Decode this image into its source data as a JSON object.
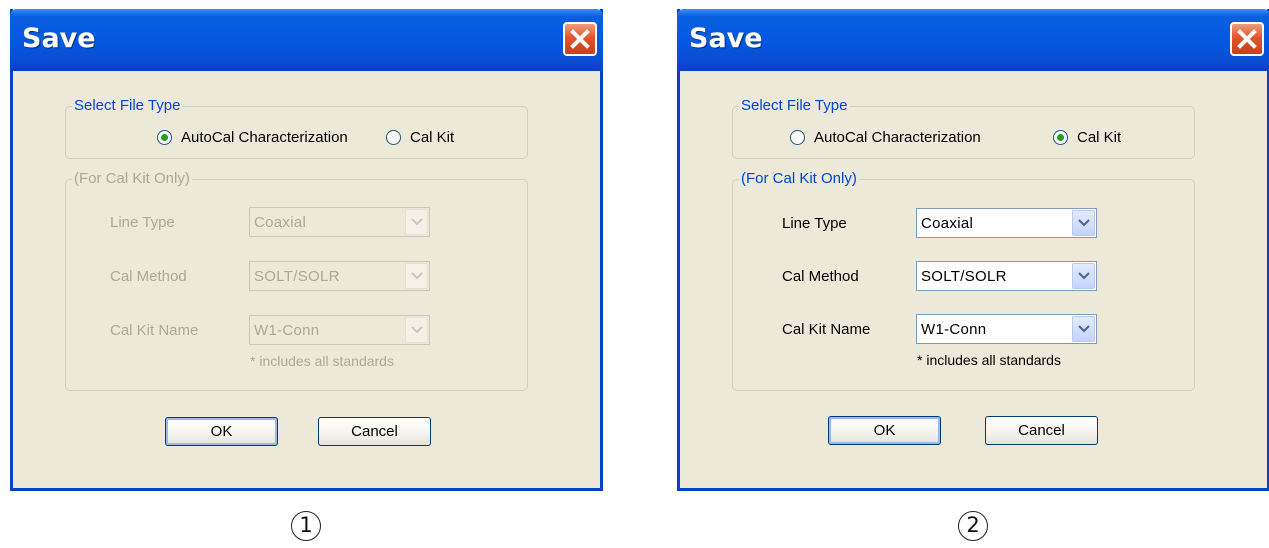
{
  "dialogs": [
    {
      "title": "Save",
      "file_type": {
        "legend": "Select File Type",
        "options": [
          "AutoCal Characterization",
          "Cal Kit"
        ],
        "selected": "AutoCal Characterization"
      },
      "cal_kit": {
        "legend": "(For Cal Kit Only)",
        "enabled": false,
        "line_type": {
          "label": "Line Type",
          "value": "Coaxial"
        },
        "cal_method": {
          "label": "Cal Method",
          "value": "SOLT/SOLR"
        },
        "cal_kit_name": {
          "label": "Cal Kit Name",
          "value": "W1-Conn"
        },
        "note": "* includes all standards"
      },
      "buttons": {
        "ok": "OK",
        "cancel": "Cancel"
      }
    },
    {
      "title": "Save",
      "file_type": {
        "legend": "Select File Type",
        "options": [
          "AutoCal Characterization",
          "Cal Kit"
        ],
        "selected": "Cal Kit"
      },
      "cal_kit": {
        "legend": "(For Cal Kit Only)",
        "enabled": true,
        "line_type": {
          "label": "Line Type",
          "value": "Coaxial"
        },
        "cal_method": {
          "label": "Cal Method",
          "value": "SOLT/SOLR"
        },
        "cal_kit_name": {
          "label": "Cal Kit Name",
          "value": "W1-Conn"
        },
        "note": "* includes all standards"
      },
      "buttons": {
        "ok": "OK",
        "cancel": "Cancel"
      }
    }
  ],
  "captions": [
    "1",
    "2"
  ],
  "icons": {
    "close": "close-icon",
    "dropdown": "chevron-down-icon"
  },
  "colors": {
    "titlebar": "#0457e1",
    "dialog_bg": "#ece9d8",
    "close_button": "#e2552c",
    "legend_active": "#0046d5",
    "disabled_text": "#aca899",
    "radio_dot": "#21a121"
  }
}
